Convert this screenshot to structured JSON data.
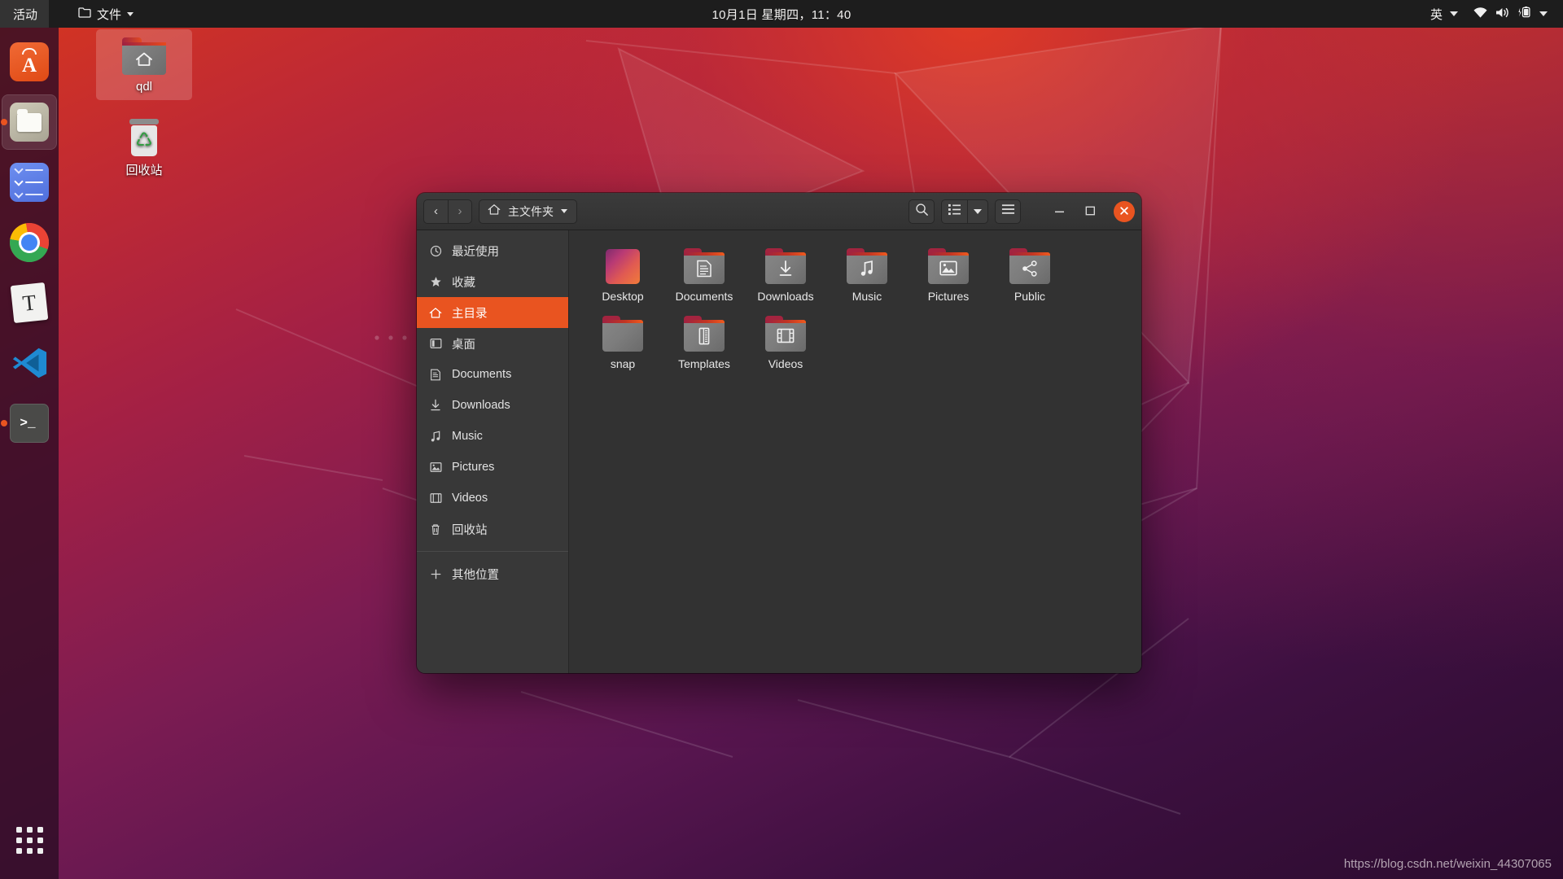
{
  "topbar": {
    "activities": "活动",
    "app_menu": {
      "label": "文件",
      "icon": "folder-icon"
    },
    "clock": "10月1日 星期四，11：40",
    "indicators": {
      "input_method": "英",
      "icons": [
        "wifi-icon",
        "volume-icon",
        "battery-charging-icon"
      ]
    }
  },
  "dock": {
    "items": [
      {
        "name": "ubuntu-software",
        "icon": "ubuntu-software-icon",
        "glyph": "A",
        "running": false,
        "active": false
      },
      {
        "name": "files",
        "icon": "files-icon",
        "running": true,
        "active": true
      },
      {
        "name": "todo",
        "icon": "todo-checklist-icon",
        "running": false,
        "active": false
      },
      {
        "name": "google-chrome",
        "icon": "chrome-icon",
        "running": false,
        "active": false
      },
      {
        "name": "text-editor",
        "icon": "text-editor-icon",
        "glyph": "T",
        "running": false,
        "active": false
      },
      {
        "name": "visual-studio-code",
        "icon": "vscode-icon",
        "running": false,
        "active": false
      },
      {
        "name": "terminal",
        "icon": "terminal-icon",
        "glyph": ">_",
        "running": true,
        "active": false
      }
    ],
    "show_applications": "show-applications-icon"
  },
  "desktop": {
    "icons": [
      {
        "label": "qdl",
        "icon": "home-folder-icon",
        "selected": true
      },
      {
        "label": "回收站",
        "icon": "trash-icon",
        "selected": false
      }
    ]
  },
  "window": {
    "title": "主文件夹",
    "nav": {
      "back": "‹",
      "forward": "›"
    },
    "header_buttons": {
      "search": "search-icon",
      "view_list": "list-view-icon",
      "view_dropdown": "chevron-down-icon",
      "menu": "hamburger-menu-icon",
      "minimize": "minimize-icon",
      "maximize": "maximize-icon",
      "close": "close-icon"
    },
    "sidebar": [
      {
        "label": "最近使用",
        "icon": "clock-icon",
        "glyph": "◷",
        "selected": false
      },
      {
        "label": "收藏",
        "icon": "star-icon",
        "glyph": "★",
        "selected": false
      },
      {
        "label": "主目录",
        "icon": "home-icon",
        "glyph": "⌂",
        "selected": true
      },
      {
        "label": "桌面",
        "icon": "desktop-icon",
        "glyph": "▢",
        "selected": false
      },
      {
        "label": "Documents",
        "icon": "documents-icon",
        "glyph": "▤",
        "selected": false
      },
      {
        "label": "Downloads",
        "icon": "downloads-icon",
        "glyph": "⇩",
        "selected": false
      },
      {
        "label": "Music",
        "icon": "music-icon",
        "glyph": "♫",
        "selected": false
      },
      {
        "label": "Pictures",
        "icon": "pictures-icon",
        "glyph": "🖾",
        "selected": false
      },
      {
        "label": "Videos",
        "icon": "videos-icon",
        "glyph": "▤",
        "selected": false
      },
      {
        "label": "回收站",
        "icon": "trash-icon",
        "glyph": "🗑",
        "selected": false
      }
    ],
    "sidebar_other": {
      "label": "其他位置",
      "icon": "plus-icon",
      "glyph": "+"
    },
    "files": [
      {
        "label": "Desktop",
        "icon": "wallpaper-thumbnail-folder-icon",
        "emblem": "",
        "kind": "picture"
      },
      {
        "label": "Documents",
        "icon": "documents-folder-icon",
        "emblem": "▤",
        "kind": "folder"
      },
      {
        "label": "Downloads",
        "icon": "downloads-folder-icon",
        "emblem": "⇩",
        "kind": "folder"
      },
      {
        "label": "Music",
        "icon": "music-folder-icon",
        "emblem": "♫",
        "kind": "folder"
      },
      {
        "label": "Pictures",
        "icon": "pictures-folder-icon",
        "emblem": "▣",
        "kind": "folder"
      },
      {
        "label": "Public",
        "icon": "public-share-folder-icon",
        "emblem": "⋖",
        "kind": "folder"
      },
      {
        "label": "snap",
        "icon": "plain-folder-icon",
        "emblem": "",
        "kind": "folder"
      },
      {
        "label": "Templates",
        "icon": "templates-folder-icon",
        "emblem": "▮",
        "kind": "folder"
      },
      {
        "label": "Videos",
        "icon": "videos-folder-icon",
        "emblem": "🎞",
        "kind": "folder"
      }
    ]
  },
  "watermark": "https://blog.csdn.net/weixin_44307065",
  "colors": {
    "accent": "#e95420",
    "topbar_bg": "#1d1d1d",
    "window_bg": "#323232",
    "sidebar_bg": "#383838",
    "header_bg": "#3b3b3b"
  }
}
